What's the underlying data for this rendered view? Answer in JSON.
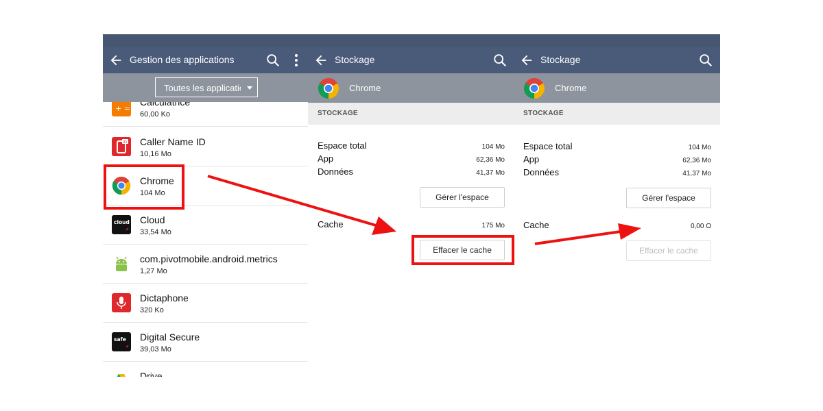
{
  "panel1": {
    "title": "Gestion des applications",
    "filter": "Toutes les applications",
    "apps": [
      {
        "name": "Calculatrice",
        "size": "60,00 Ko",
        "icon": "calculator-icon"
      },
      {
        "name": "Caller Name ID",
        "size": "10,16 Mo",
        "icon": "caller-id-icon"
      },
      {
        "name": "Chrome",
        "size": "104 Mo",
        "icon": "chrome-icon"
      },
      {
        "name": "Cloud",
        "size": "33,54 Mo",
        "icon": "cloud-icon"
      },
      {
        "name": "com.pivotmobile.android.metrics",
        "size": "1,27 Mo",
        "icon": "android-icon"
      },
      {
        "name": "Dictaphone",
        "size": "320 Ko",
        "icon": "microphone-icon"
      },
      {
        "name": "Digital Secure",
        "size": "39,03 Mo",
        "icon": "safe-icon"
      },
      {
        "name": "Drive",
        "size": "",
        "icon": "drive-icon"
      }
    ],
    "icon_labels": {
      "cloud": "cloud",
      "safe": "safe",
      "caller": "ID"
    }
  },
  "panel2": {
    "title": "Stockage",
    "app_name": "Chrome",
    "section": "STOCKAGE",
    "rows": [
      {
        "label": "Espace total",
        "value": "104 Mo"
      },
      {
        "label": "App",
        "value": "62,36 Mo"
      },
      {
        "label": "Données",
        "value": "41,37 Mo"
      }
    ],
    "manage_button": "Gérer l'espace",
    "cache_label": "Cache",
    "cache_value": "175 Mo",
    "clear_button": "Effacer le cache"
  },
  "panel3": {
    "title": "Stockage",
    "app_name": "Chrome",
    "section": "STOCKAGE",
    "rows": [
      {
        "label": "Espace total",
        "value": "104 Mo"
      },
      {
        "label": "App",
        "value": "62,36 Mo"
      },
      {
        "label": "Données",
        "value": "41,37 Mo"
      }
    ],
    "manage_button": "Gérer l'espace",
    "cache_label": "Cache",
    "cache_value": "0,00 O",
    "clear_button": "Effacer le cache"
  },
  "colors": {
    "toolbar": "#4a5a79",
    "subheader": "#8e949e",
    "annotation": "#ee1111"
  }
}
